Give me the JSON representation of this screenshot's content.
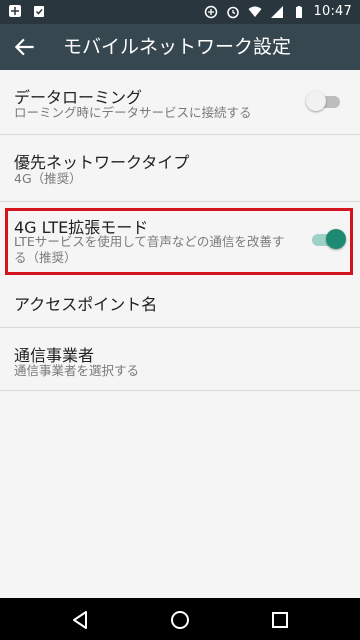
{
  "status_bar": {
    "time": "10:47",
    "left_icons": [
      "app-icon",
      "clipboard-icon"
    ],
    "right_icons": [
      "sync-icon",
      "alarm-icon",
      "wifi-icon",
      "signal-icon",
      "battery-icon"
    ]
  },
  "app_bar": {
    "back_icon": "arrow-back-icon",
    "title": "モバイルネットワーク設定"
  },
  "settings": {
    "data_roaming": {
      "title": "データローミング",
      "summary": "ローミング時にデータサービスに接続する",
      "toggle_on": false
    },
    "preferred_network": {
      "title": "優先ネットワークタイプ",
      "summary": "4G（推奨）"
    },
    "lte_mode": {
      "title": "4G LTE拡張モード",
      "summary_line1": "LTEサービスを使用して音声などの通信を改善す",
      "summary_line2": "る（推奨）",
      "toggle_on": true
    },
    "apn": {
      "title": "アクセスポイント名"
    },
    "carrier": {
      "title": "通信事業者",
      "summary": "通信事業者を選択する"
    }
  },
  "colors": {
    "status_bar": "#2a363d",
    "app_bar": "#37474f",
    "background": "#f5f5f5",
    "toggle_on": "#1e8a72",
    "highlight": "#d3141c"
  },
  "nav_bar": [
    "back-triangle-icon",
    "home-circle-icon",
    "recents-square-icon"
  ]
}
